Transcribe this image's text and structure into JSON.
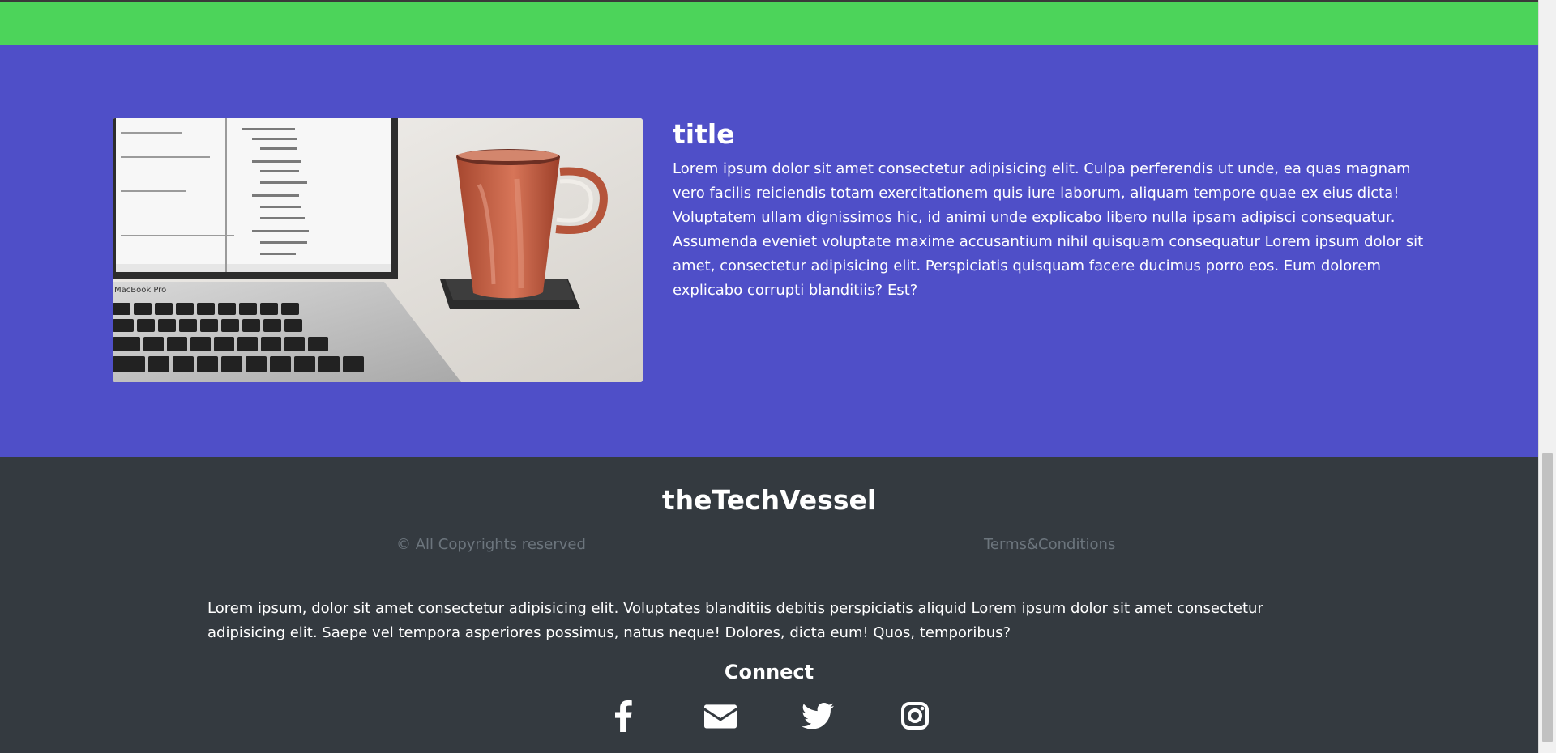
{
  "feature": {
    "title": "title",
    "body": "Lorem ipsum dolor sit amet consectetur adipisicing elit. Culpa perferendis ut unde, ea quas magnam vero facilis reiciendis totam exercitationem quis iure laborum, aliquam tempore quae ex eius dicta! Voluptatem ullam dignissimos hic, id animi unde explicabo libero nulla ipsam adipisci consequatur. Assumenda eveniet voluptate maxime accusantium nihil quisquam consequatur Lorem ipsum dolor sit amet, consectetur adipisicing elit. Perspiciatis quisquam facere ducimus porro eos. Eum dolorem explicabo corrupti blanditiis? Est?",
    "image_caption": "MacBook Pro"
  },
  "footer": {
    "brand": "theTechVessel",
    "copyright": "© All Copyrights reserved",
    "terms": "Terms&Conditions",
    "body": "Lorem ipsum, dolor sit amet consectetur adipisicing elit. Voluptates blanditiis debitis perspiciatis aliquid Lorem ipsum dolor sit amet consectetur adipisicing elit. Saepe vel tempora asperiores possimus, natus neque! Dolores, dicta eum! Quos, temporibus?",
    "connect": "Connect",
    "social_icons": [
      "facebook-icon",
      "envelope-icon",
      "twitter-icon",
      "instagram-icon"
    ]
  },
  "colors": {
    "green_bar": "#4cd45a",
    "feature_background": "#4f4fc8",
    "footer_background": "#343a40",
    "muted_text": "#6c757d"
  }
}
